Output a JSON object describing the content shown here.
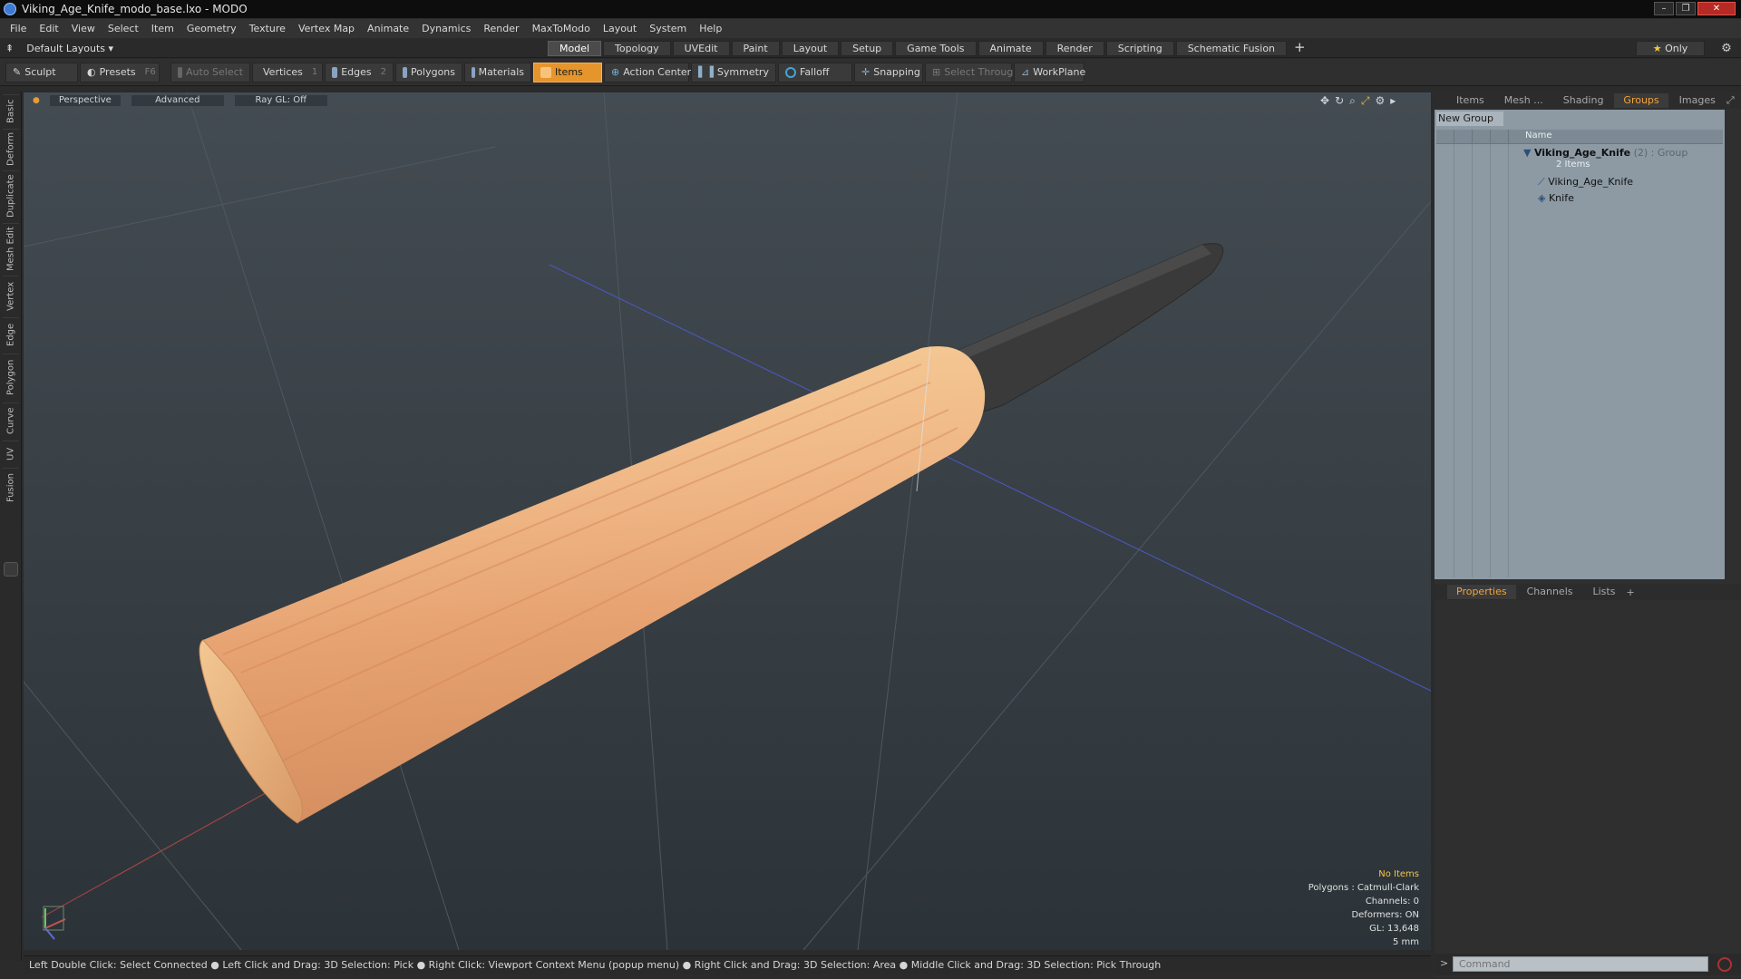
{
  "window": {
    "title": "Viking_Age_Knife_modo_base.lxo - MODO",
    "controls": [
      "–",
      "❐",
      "✕"
    ]
  },
  "menu": [
    "File",
    "Edit",
    "View",
    "Select",
    "Item",
    "Geometry",
    "Texture",
    "Vertex Map",
    "Animate",
    "Dynamics",
    "Render",
    "MaxToModo",
    "Layout",
    "System",
    "Help"
  ],
  "layouts": {
    "label": "Default Layouts",
    "tabs": [
      "Model",
      "Topology",
      "UVEdit",
      "Paint",
      "Layout",
      "Setup",
      "Game Tools",
      "Animate",
      "Render",
      "Scripting",
      "Schematic Fusion"
    ],
    "active_tab": "Model",
    "only_label": "Only"
  },
  "toolbar": {
    "sculpt": "Sculpt",
    "presets": "Presets",
    "presets_key": "F6",
    "auto_select": "Auto Select",
    "vertices": "Vertices",
    "vertices_count": "1",
    "edges": "Edges",
    "edges_count": "2",
    "polygons": "Polygons",
    "materials": "Materials",
    "items": "Items",
    "action_center": "Action Center",
    "symmetry": "Symmetry",
    "falloff": "Falloff",
    "snapping": "Snapping",
    "select_through": "Select Through",
    "workplane": "WorkPlane"
  },
  "left_tabs": [
    "Basic",
    "Deform",
    "Duplicate",
    "Mesh Edit",
    "Vertex",
    "Edge",
    "Polygon",
    "Curve",
    "UV",
    "Fusion"
  ],
  "viewport": {
    "view_mode": "Perspective",
    "shading": "Advanced",
    "raygl": "Ray GL: Off",
    "stats": {
      "selection": "No Items",
      "polygons": "Polygons : Catmull-Clark",
      "channels": "Channels: 0",
      "deformers": "Deformers: ON",
      "gl": "GL: 13,648",
      "scale": "5 mm"
    },
    "colors": {
      "bg_top": "#3e464d",
      "bg_bottom": "#2f363c",
      "handle": "#e8b07a",
      "blade": "#3a3a3a"
    }
  },
  "status_bar": "Left Double Click: Select Connected ● Left Click and Drag: 3D Selection: Pick ● Right Click: Viewport Context Menu (popup menu) ● Right Click and Drag: 3D Selection: Area ● Middle Click and Drag: 3D Selection: Pick Through",
  "right_panel": {
    "top_tabs": [
      "Items",
      "Mesh ...",
      "Shading",
      "Groups",
      "Images"
    ],
    "active_top_tab": "Groups",
    "new_group": "New Group",
    "column_name": "Name",
    "group": {
      "name": "Viking_Age_Knife",
      "count": "(2)",
      "type": ": Group",
      "items_label": "2 Items"
    },
    "children": [
      "Viking_Age_Knife",
      "Knife"
    ],
    "bottom_tabs": [
      "Properties",
      "Channels",
      "Lists"
    ],
    "active_bottom_tab": "Properties"
  },
  "command": {
    "placeholder": "Command"
  }
}
